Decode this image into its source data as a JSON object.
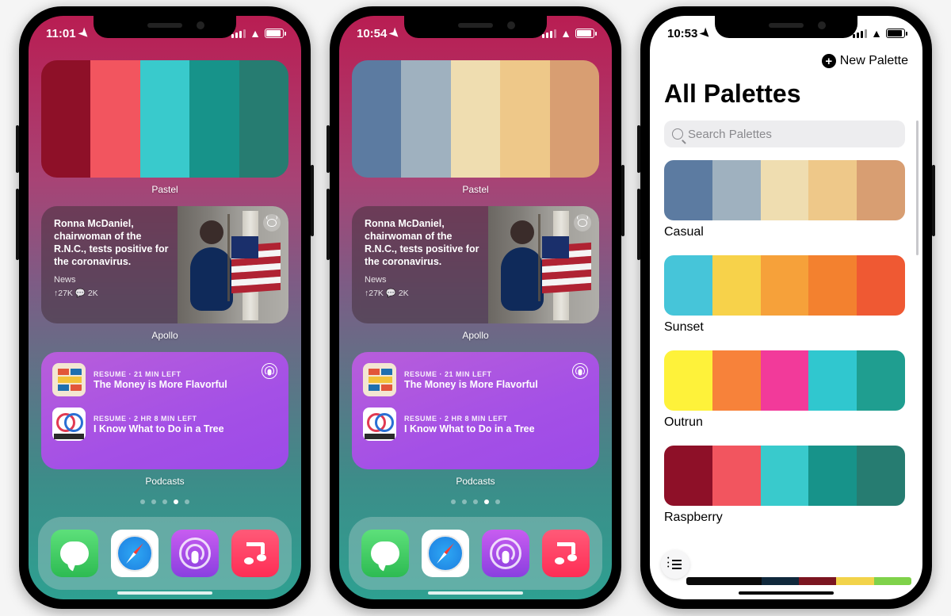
{
  "phones": [
    {
      "time": "11:01",
      "widget_palette": {
        "label": "Pastel",
        "colors": [
          "#8e1028",
          "#f2555f",
          "#39cacc",
          "#17938a",
          "#267c71"
        ]
      },
      "widget_apollo": {
        "label": "Apollo",
        "headline": "Ronna McDaniel, chairwoman of the R.N.C., tests positive for the coronavirus.",
        "source": "News",
        "meta": "↑27K  💬 2K"
      },
      "widget_podcasts": {
        "label": "Podcasts",
        "items": [
          {
            "meta": "RESUME · 21 MIN LEFT",
            "title": "The Money is More Flavorful"
          },
          {
            "meta": "RESUME · 2 HR 8 MIN LEFT",
            "title": "I Know What to Do in a Tree"
          }
        ]
      }
    },
    {
      "time": "10:54",
      "widget_palette": {
        "label": "Pastel",
        "colors": [
          "#5c7ba1",
          "#9fb1bf",
          "#efddb0",
          "#eec889",
          "#d89e72"
        ]
      },
      "widget_apollo": {
        "label": "Apollo",
        "headline": "Ronna McDaniel, chairwoman of the R.N.C., tests positive for the coronavirus.",
        "source": "News",
        "meta": "↑27K  💬 2K"
      },
      "widget_podcasts": {
        "label": "Podcasts",
        "items": [
          {
            "meta": "RESUME · 21 MIN LEFT",
            "title": "The Money is More Flavorful"
          },
          {
            "meta": "RESUME · 2 HR 8 MIN LEFT",
            "title": "I Know What to Do in a Tree"
          }
        ]
      }
    }
  ],
  "dock": [
    "Messages",
    "Safari",
    "Podcasts",
    "Music"
  ],
  "app": {
    "time": "10:53",
    "new_button": "New Palette",
    "title": "All Palettes",
    "search_placeholder": "Search Palettes",
    "palettes": [
      {
        "name": "Casual",
        "colors": [
          "#5c7ba1",
          "#9fb1bf",
          "#efddb0",
          "#eec889",
          "#d89e72"
        ]
      },
      {
        "name": "Sunset",
        "colors": [
          "#46c5d9",
          "#f7d24a",
          "#f6a13a",
          "#f3812f",
          "#ef5933"
        ]
      },
      {
        "name": "Outrun",
        "colors": [
          "#fef23a",
          "#f7823a",
          "#f23a9a",
          "#30c7cf",
          "#1f9e90"
        ]
      },
      {
        "name": "Raspberry",
        "colors": [
          "#8e1028",
          "#f2555f",
          "#39cacc",
          "#17938a",
          "#267c71"
        ]
      }
    ],
    "bottom_strip": [
      "#0a0a0a",
      "#0a0a0a",
      "#10283b",
      "#7b1520",
      "#f2d34a",
      "#7fd24a"
    ]
  }
}
